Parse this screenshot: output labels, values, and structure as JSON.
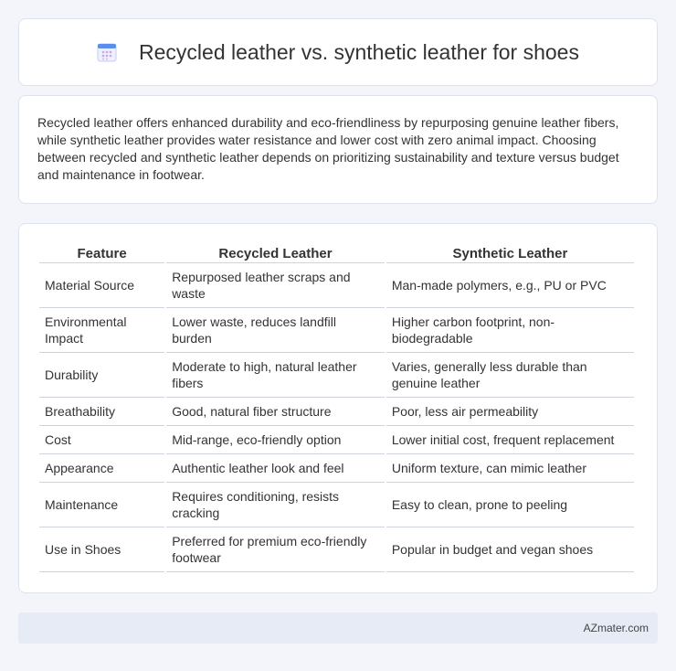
{
  "title": "Recycled leather vs. synthetic leather for shoes",
  "summary": "Recycled leather offers enhanced durability and eco-friendliness by repurposing genuine leather fibers, while synthetic leather provides water resistance and lower cost with zero animal impact. Choosing between recycled and synthetic leather depends on prioritizing sustainability and texture versus budget and maintenance in footwear.",
  "table": {
    "headers": [
      "Feature",
      "Recycled Leather",
      "Synthetic Leather"
    ],
    "rows": [
      [
        "Material Source",
        "Repurposed leather scraps and waste",
        "Man-made polymers, e.g., PU or PVC"
      ],
      [
        "Environmental Impact",
        "Lower waste, reduces landfill burden",
        "Higher carbon footprint, non-biodegradable"
      ],
      [
        "Durability",
        "Moderate to high, natural leather fibers",
        "Varies, generally less durable than genuine leather"
      ],
      [
        "Breathability",
        "Good, natural fiber structure",
        "Poor, less air permeability"
      ],
      [
        "Cost",
        "Mid-range, eco-friendly option",
        "Lower initial cost, frequent replacement"
      ],
      [
        "Appearance",
        "Authentic leather look and feel",
        "Uniform texture, can mimic leather"
      ],
      [
        "Maintenance",
        "Requires conditioning, resists cracking",
        "Easy to clean, prone to peeling"
      ],
      [
        "Use in Shoes",
        "Preferred for premium eco-friendly footwear",
        "Popular in budget and vegan shoes"
      ]
    ]
  },
  "footer": "AZmater.com",
  "icon": "calendar-icon",
  "colors": {
    "background": "#f3f5fa",
    "footer_bg": "#e6ebf5",
    "icon_top": "#5b8def",
    "icon_dots": "#c9a6e8"
  }
}
